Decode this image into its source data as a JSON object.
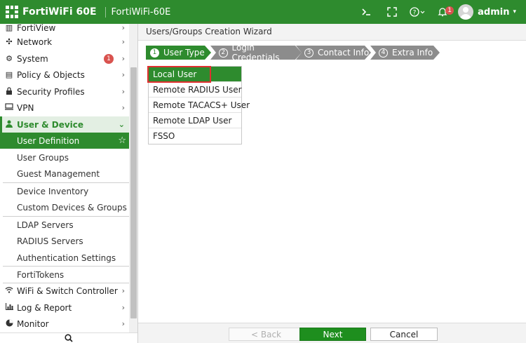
{
  "header": {
    "model": "FortiWiFi 60E",
    "hostname": "FortiWiFi-60E",
    "notification_count": "1",
    "user": "admin",
    "icons": [
      "cli-console-icon",
      "fullscreen-icon",
      "help-icon",
      "bell-icon",
      "avatar"
    ]
  },
  "sidebar": {
    "items": [
      {
        "label": "FortiView",
        "icon": "fortiview-icon"
      },
      {
        "label": "Network",
        "icon": "network-icon"
      },
      {
        "label": "System",
        "icon": "gear-icon",
        "badge": "1"
      },
      {
        "label": "Policy & Objects",
        "icon": "policy-icon"
      },
      {
        "label": "Security Profiles",
        "icon": "lock-icon"
      },
      {
        "label": "VPN",
        "icon": "vpn-icon"
      },
      {
        "label": "User & Device",
        "icon": "user-icon"
      }
    ],
    "sub_items": [
      {
        "label": "User Definition"
      },
      {
        "label": "User Groups"
      },
      {
        "label": "Guest Management"
      },
      {
        "label": "Device Inventory"
      },
      {
        "label": "Custom Devices & Groups"
      },
      {
        "label": "LDAP Servers"
      },
      {
        "label": "RADIUS Servers"
      },
      {
        "label": "Authentication Settings"
      },
      {
        "label": "FortiTokens"
      }
    ],
    "bottom_items": [
      {
        "label": "WiFi & Switch Controller",
        "icon": "wifi-icon"
      },
      {
        "label": "Log & Report",
        "icon": "chart-icon"
      },
      {
        "label": "Monitor",
        "icon": "monitor-icon"
      }
    ]
  },
  "main": {
    "title": "Users/Groups Creation Wizard",
    "steps": [
      {
        "num": "1",
        "label": "User Type"
      },
      {
        "num": "2",
        "label": "Login Credentials"
      },
      {
        "num": "3",
        "label": "Contact Info"
      },
      {
        "num": "4",
        "label": "Extra Info"
      }
    ],
    "options": [
      "Local User",
      "Remote RADIUS User",
      "Remote TACACS+ User",
      "Remote LDAP User",
      "FSSO"
    ],
    "buttons": {
      "back": "< Back",
      "next": "Next",
      "cancel": "Cancel"
    }
  },
  "colors": {
    "brand_green": "#2e8b2e",
    "inactive_step": "#8c8c8c",
    "selection_outline": "#e03030",
    "badge_red": "#d9534f"
  }
}
